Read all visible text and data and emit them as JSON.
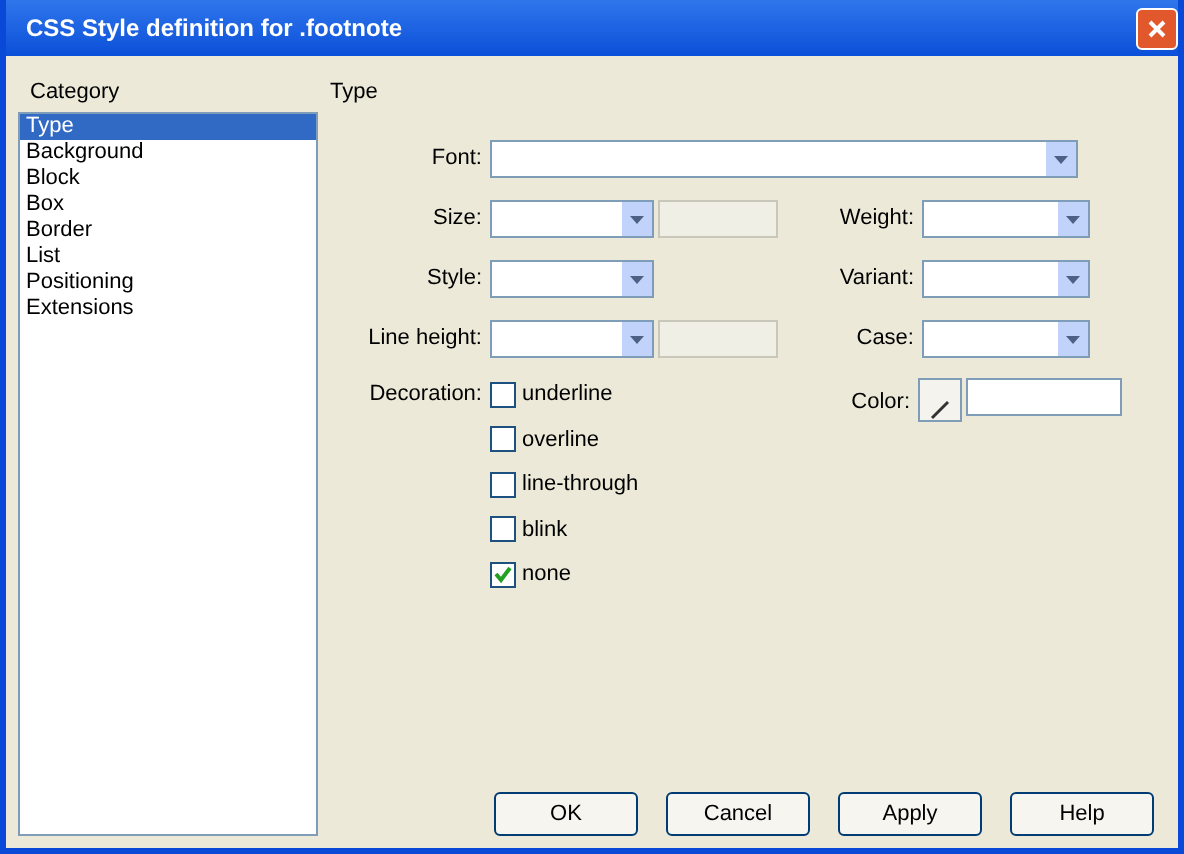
{
  "window": {
    "title": "CSS Style definition for .footnote"
  },
  "category_label": "Category",
  "categories": [
    {
      "label": "Type",
      "selected": true
    },
    {
      "label": "Background",
      "selected": false
    },
    {
      "label": "Block",
      "selected": false
    },
    {
      "label": "Box",
      "selected": false
    },
    {
      "label": "Border",
      "selected": false
    },
    {
      "label": "List",
      "selected": false
    },
    {
      "label": "Positioning",
      "selected": false
    },
    {
      "label": "Extensions",
      "selected": false
    }
  ],
  "panel_title": "Type",
  "font": {
    "label": "Font:"
  },
  "rows": [
    {
      "left": {
        "label": "Size:",
        "unit": true
      },
      "right": {
        "label": "Weight:"
      }
    },
    {
      "left": {
        "label": "Style:",
        "unit": false
      },
      "right": {
        "label": "Variant:"
      }
    },
    {
      "left": {
        "label": "Line height:",
        "unit": true
      },
      "right": {
        "label": "Case:"
      }
    }
  ],
  "decoration": {
    "label": "Decoration:",
    "options": [
      {
        "label": "underline",
        "checked": false
      },
      {
        "label": "overline",
        "checked": false
      },
      {
        "label": "line-through",
        "checked": false
      },
      {
        "label": "blink",
        "checked": false
      },
      {
        "label": "none",
        "checked": true
      }
    ]
  },
  "color": {
    "label": "Color:"
  },
  "buttons": [
    "OK",
    "Cancel",
    "Apply",
    "Help"
  ]
}
